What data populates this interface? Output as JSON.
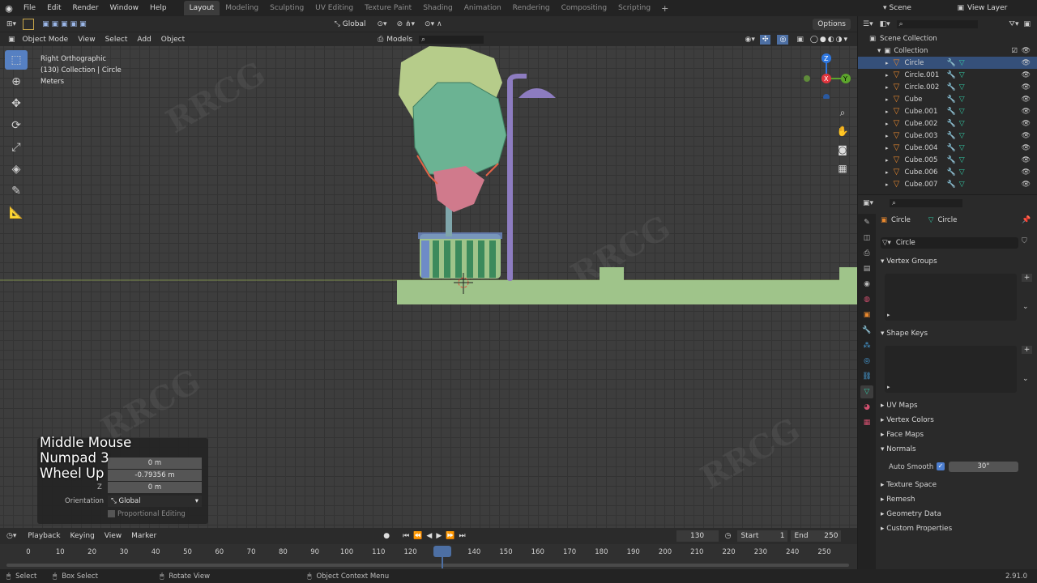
{
  "topbar": {
    "menus": [
      "File",
      "Edit",
      "Render",
      "Window",
      "Help"
    ],
    "workspaces": [
      "Layout",
      "Modeling",
      "Sculpting",
      "UV Editing",
      "Texture Paint",
      "Shading",
      "Animation",
      "Rendering",
      "Compositing",
      "Scripting"
    ],
    "active_workspace": "Layout",
    "scene": "Scene",
    "view_layer": "View Layer"
  },
  "viewport_header": {
    "mode": "Object Mode",
    "menus": [
      "View",
      "Select",
      "Add",
      "Object"
    ],
    "orientation": "Global",
    "snap_target": "Models",
    "options": "Options"
  },
  "view_info": {
    "line1": "Right Orthographic",
    "line2": "(130) Collection | Circle",
    "line3": "Meters"
  },
  "overlay_keys": [
    "Middle Mouse",
    "Numpad 3",
    "Wheel Up"
  ],
  "operator": {
    "x": "0 m",
    "y": "-0.79356 m",
    "z_label": "Z",
    "z": "0 m",
    "orientation_label": "Orientation",
    "orientation": "Global",
    "proportional": "Proportional Editing"
  },
  "timeline": {
    "menus": [
      "Playback",
      "Keying",
      "View",
      "Marker"
    ],
    "current_frame": "130",
    "start_label": "Start",
    "start": "1",
    "end_label": "End",
    "end": "250",
    "ticks": [
      "0",
      "10",
      "20",
      "30",
      "40",
      "50",
      "60",
      "70",
      "80",
      "90",
      "100",
      "110",
      "120",
      "130",
      "140",
      "150",
      "160",
      "170",
      "180",
      "190",
      "200",
      "210",
      "220",
      "230",
      "240",
      "250"
    ]
  },
  "statusbar": {
    "select": "Select",
    "box_select": "Box Select",
    "rotate_view": "Rotate View",
    "context_menu": "Object Context Menu",
    "version": "2.91.0"
  },
  "outliner": {
    "scene_collection": "Scene Collection",
    "collection": "Collection",
    "items": [
      {
        "name": "Circle",
        "selected": true
      },
      {
        "name": "Circle.001"
      },
      {
        "name": "Circle.002"
      },
      {
        "name": "Cube"
      },
      {
        "name": "Cube.001"
      },
      {
        "name": "Cube.002"
      },
      {
        "name": "Cube.003"
      },
      {
        "name": "Cube.004"
      },
      {
        "name": "Cube.005"
      },
      {
        "name": "Cube.006"
      },
      {
        "name": "Cube.007"
      }
    ]
  },
  "properties": {
    "object_name": "Circle",
    "data_name": "Circle",
    "mesh_name": "Circle",
    "panels": {
      "vertex_groups": "Vertex Groups",
      "shape_keys": "Shape Keys",
      "uv_maps": "UV Maps",
      "vertex_colors": "Vertex Colors",
      "face_maps": "Face Maps",
      "normals": "Normals",
      "auto_smooth": "Auto Smooth",
      "auto_smooth_angle": "30°",
      "texture_space": "Texture Space",
      "remesh": "Remesh",
      "geometry_data": "Geometry Data",
      "custom_properties": "Custom Properties"
    }
  },
  "colors": {
    "accent": "#5680c2",
    "selection": "#35507a",
    "ground": "#9fc48a",
    "lamp": "#8d7cc0",
    "tree_top": "#6bb393",
    "tree_upper": "#b6cc8a"
  }
}
